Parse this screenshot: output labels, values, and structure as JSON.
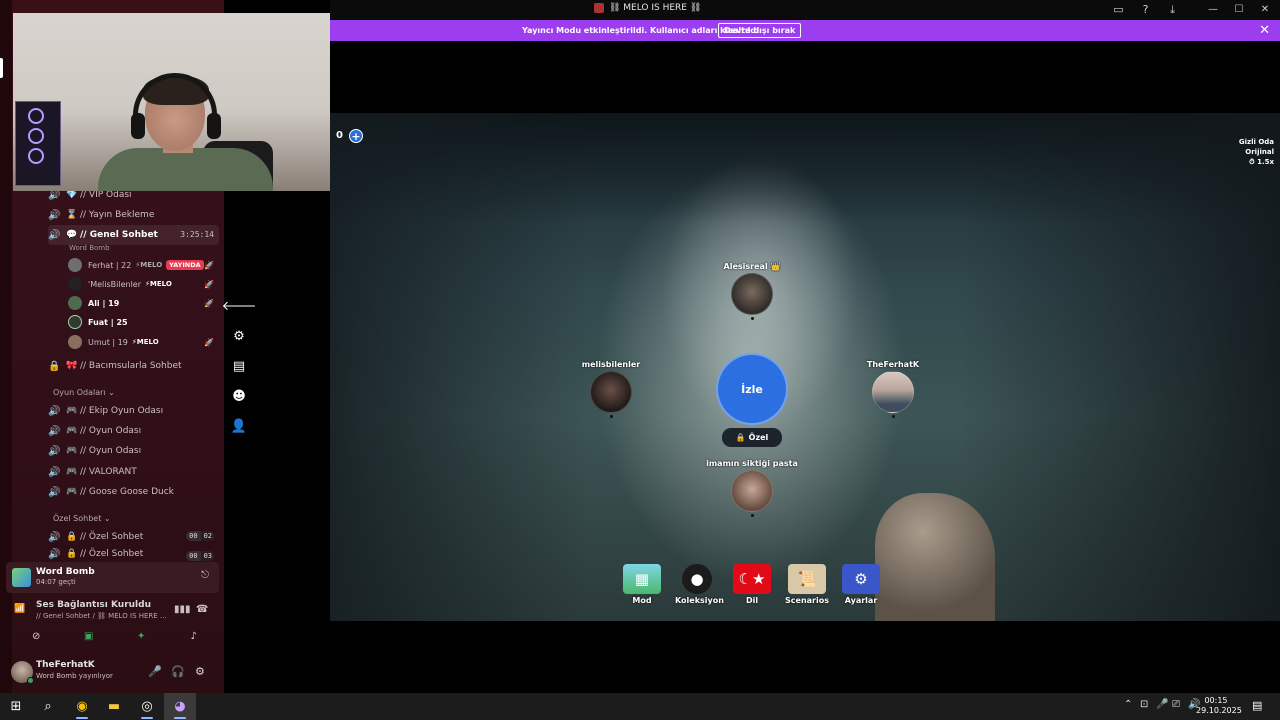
{
  "titlebar": {
    "title": "⛓ MELO IS HERE ⛓"
  },
  "banner": {
    "text": "Yayıncı Modu etkinleştirildi. Kullanıcı adları kısaltıldı.",
    "button_label": "Devre dışı bırak"
  },
  "channels": {
    "vip": "// VIP Odası",
    "yayin_bekleme": "// Yayın Bekleme",
    "genel_sohbet": "// Genel Sohbet",
    "genel_timer": "3:25:14",
    "genel_activity": "Word Bomb",
    "bacimsular": "// Bacımsularla Sohbet",
    "oyun_category": "Oyun Odaları",
    "ekip": "// Ekip Oyun Odası",
    "oyun1": "// Oyun Odası",
    "oyun2": "// Oyun Odası",
    "valorant": "// VALORANT",
    "goose": "// Goose Goose Duck",
    "ozel_category": "Özel Sohbet",
    "ozel1": "// Özel Sohbet",
    "ozel1_a": "00",
    "ozel1_b": "02",
    "ozel2": "// Özel Sohbet",
    "ozel2_a": "00",
    "ozel2_b": "03"
  },
  "voice_users": [
    {
      "name": "Ferhat | 22",
      "tag": "MELO",
      "live": "YAYINDA"
    },
    {
      "name": "'MelisBilenler",
      "tag": "MELO"
    },
    {
      "name": "Ali | 19"
    },
    {
      "name": "Fuat | 25"
    },
    {
      "name": "Umut | 19",
      "tag": "MELO"
    }
  ],
  "activity": {
    "title": "Word Bomb",
    "sub": "04:07 geçti"
  },
  "voice_connection": {
    "title": "Ses Bağlantısı Kuruldu",
    "sub": "// Genel Sohbet / ⛓ MELO IS HERE ..."
  },
  "user_panel": {
    "name": "TheFerhatK",
    "status": "Word Bomb yayınlıyor"
  },
  "game": {
    "score": "0",
    "plus": "+",
    "room_name": "Gizli Oda",
    "room_mode": "Orijinal",
    "room_speed": "⏱ 1.5x",
    "watch_label": "İzle",
    "private_label": "Özel",
    "players": [
      {
        "name": "Alesisreal 👑"
      },
      {
        "name": "melisbilenler"
      },
      {
        "name": "TheFerhatK"
      },
      {
        "name": "imamın siktiği pasta"
      }
    ],
    "menu": [
      {
        "label": "Mod",
        "icon": "word-icon",
        "color": "#4cb86a"
      },
      {
        "label": "Koleksiyon",
        "icon": "bomb-icon",
        "color": "#1b1b1b"
      },
      {
        "label": "Dil",
        "icon": "flag-icon",
        "color": "#e30a17"
      },
      {
        "label": "Scenarios",
        "icon": "scroll-icon",
        "color": "#d8c8a8"
      },
      {
        "label": "Ayarlar",
        "icon": "gear-icon",
        "color": "#3a56c8"
      }
    ]
  },
  "taskbar": {
    "time": "00:15",
    "date": "29.10.2025"
  },
  "colors": {
    "accent": "#9c3ef0",
    "watch": "#2b6fe0",
    "live": "#e83a50",
    "online": "#3ba55d"
  }
}
